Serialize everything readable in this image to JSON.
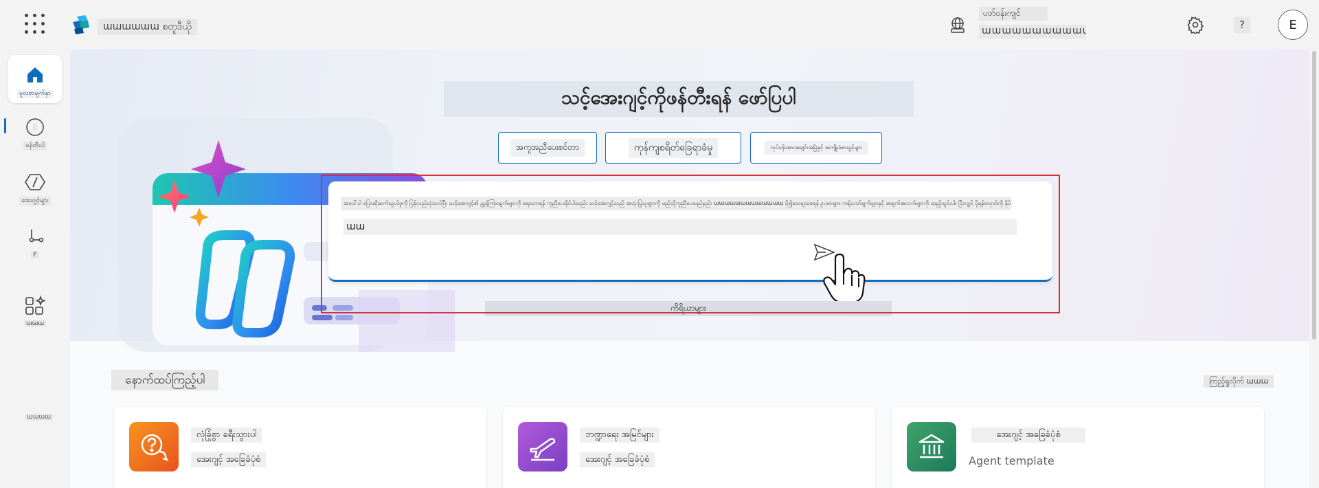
{
  "app": {
    "name": "ɯɯɯɯɯɯ စတူဒီယို"
  },
  "header": {
    "environment_label": "ပတ်ဝန်းကျင်",
    "environment_name": "ɯɯɯɯɯɯɯɯɯɯɯɯɯɯ",
    "help_label": "?",
    "avatar_initial": "E"
  },
  "sidebar": {
    "items": [
      {
        "label": "မူလစာမျက်နှာ",
        "icon": "home-icon",
        "active": true
      },
      {
        "label": "ဖန်တီးပါ",
        "icon": "create-icon"
      },
      {
        "label": "အေးဂျင့်များ",
        "icon": "agents-icon"
      },
      {
        "label": "F",
        "icon": "flows-icon"
      },
      {
        "label": "ɯɯɯ",
        "icon": "apps-icon"
      }
    ],
    "more_label": "ɯɯɯɯ"
  },
  "hero": {
    "title": "သင့်အေးဂျင့်ကိုဖန်တီးရန် ဖော်ပြပါ",
    "chips": [
      {
        "label": "အကူအညီပေးစင်တာ"
      },
      {
        "label": "ကုန်ကျစရိတ်ခြေရာခံမှု"
      },
      {
        "label": "လုပ်ငန်းအားအချင်းအမြဲနှင့် အကျိုးခံစားခွင့်များ"
      }
    ],
    "prompt_text": "အပေါ်ပါ ပြောဆိုဆက်သွယ်မှုကို ပြန်လည်သုံးသပ်ပြီး သင့်အေးဂျင့်၏ ညွှန်ကြားချက်များကို ရေးသားရန် ကူညီပေးနိုင်ပါသည်။ သင့်အေးဂျင့်သည် အသုံးပြုသူများကို မည်သို့ကူညီပေးမည်နည်း ɯɯɯɯɯɯɯɯɯɯɯɯɯ ပို၍သေချာစေရန် ဥပမာများ၊ ကန့်သတ်ချက်များနှင့် အချက်အလက်များကို ထည့်သွင်းပါ။ ပြီးလျှင် ပို့ရန်ခလုတ်ကို နှိပ်ပါ။",
    "prompt_input": "ɯɯ",
    "examples_label": "ကိရိယာများ"
  },
  "explore": {
    "title": "နောက်ထပ်ကြည့်ပါ",
    "see_more": "ကြည့်ရှုလိုက် ɯɯɯ",
    "cards": [
      {
        "title": "လုံခြုံစွာ ခရီးသွားပါ",
        "subtitle": "အေးဂျင့် အခြေခံပုံစံ",
        "icon": "help-chat-icon",
        "color_from": "#f7941d",
        "color_to": "#e8531f"
      },
      {
        "title": "ဘဏ္ဍာရေး အမြင်များ",
        "subtitle": "အေးဂျင့် အခြေခံပုံစံ",
        "icon": "airplane-icon",
        "color_from": "#b15ad8",
        "color_to": "#7b3fc4"
      },
      {
        "title": "အေးဂျင့် အခြေခံပုံစံ",
        "subtitle": "Agent template",
        "icon": "bank-icon",
        "color_from": "#3fa36b",
        "color_to": "#1e7a5a"
      }
    ]
  },
  "colors": {
    "accent": "#0f6cbd",
    "highlight": "#d13438"
  }
}
